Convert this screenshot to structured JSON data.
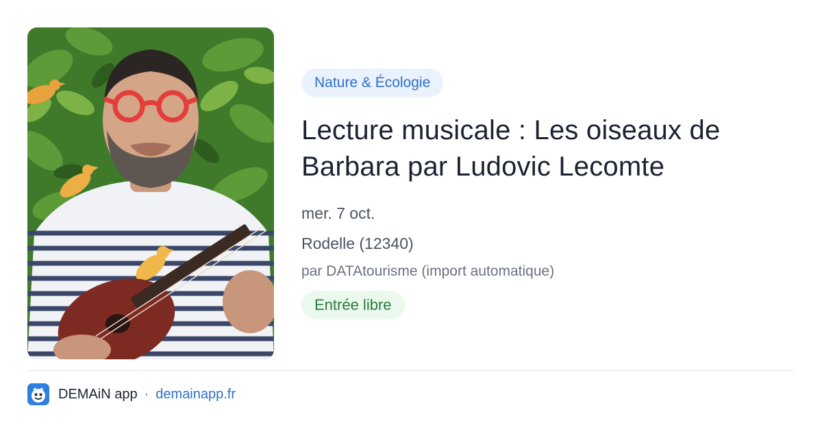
{
  "event": {
    "category": "Nature & Écologie",
    "title": "Lecture musicale : Les oiseaux de Barbara par Ludovic Lecomte",
    "date": "mer. 7 oct.",
    "location": "Rodelle (12340)",
    "source": "par DATAtourisme (import automatique)",
    "price": "Entrée libre"
  },
  "footer": {
    "app_name": "DEMAiN app",
    "separator": "·",
    "domain": "demainapp.fr",
    "logo_icon": "demain-app-logo-icon"
  },
  "colors": {
    "category_bg": "#eaf2fd",
    "category_text": "#2f6fc9",
    "price_bg": "#ebf8ee",
    "price_text": "#2a7a3b",
    "title_text": "#1b2232",
    "link": "#2f6fc9"
  }
}
